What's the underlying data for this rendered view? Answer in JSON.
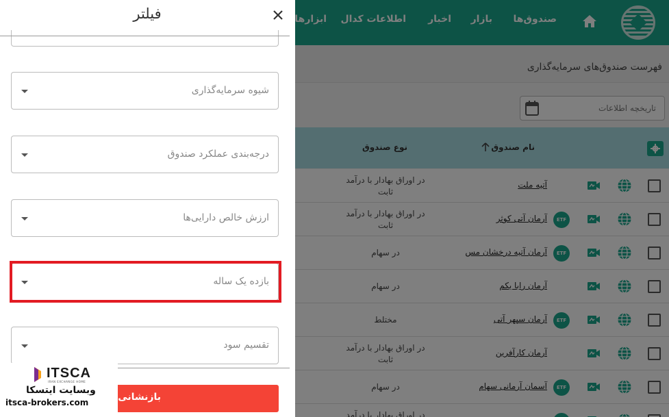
{
  "nav": {
    "items": [
      "صندوق‌ها",
      "بازار",
      "اخبار",
      "اطلاعات کدال",
      "ابزارها"
    ]
  },
  "page": {
    "title": "فهرست صندوق‌های سرمایه‌گذاری",
    "date_placeholder": "تاریخچه اطلاعات"
  },
  "table": {
    "headers": {
      "name": "نام صندوق",
      "type": "نوع صندوق"
    },
    "rows": [
      {
        "name": "آتیه ملت",
        "etf": false,
        "type": "در اوراق بهادار با درآمد ثابت"
      },
      {
        "name": "آرمان آتی کوثر",
        "etf": true,
        "type": "در اوراق بهادار با درآمد ثابت"
      },
      {
        "name": "آرمان آتیه درخشان مس",
        "etf": true,
        "type": "در سهام"
      },
      {
        "name": "آرمان رابا یکم",
        "etf": false,
        "type": "در سهام"
      },
      {
        "name": "آرمان سپهر آتی",
        "etf": true,
        "type": "مختلط"
      },
      {
        "name": "آرمان کارآفرین",
        "etf": false,
        "type": "در اوراق بهادار با درآمد ثابت"
      },
      {
        "name": "آسمان آرمانی سهام",
        "etf": true,
        "type": "در سهام"
      },
      {
        "name": "",
        "etf": true,
        "type": "در اوراق بهادار با درآمد"
      }
    ],
    "etf_badge": "ETF"
  },
  "filter": {
    "title": "فیلتر",
    "fields": [
      {
        "label": "شیوه سرمایه‌گذاری"
      },
      {
        "label": "درجه‌بندی عملکرد صندوق"
      },
      {
        "label": "ارزش خالص دارایی‌ها"
      },
      {
        "label": "بازده یک ساله"
      },
      {
        "label": "تقسیم سود"
      }
    ],
    "reset_label": "بازنشانی"
  },
  "watermark": {
    "brand": "ITSCA",
    "tagline": "IRAN EXCHANGE HOME",
    "fa": "وبسایت ایتسکا",
    "url": "itsca-brokers.com"
  },
  "colors": {
    "primary": "#1ba68c",
    "reset": "#f44336",
    "highlight": "#e21b23",
    "table_head": "#a9dde3"
  }
}
